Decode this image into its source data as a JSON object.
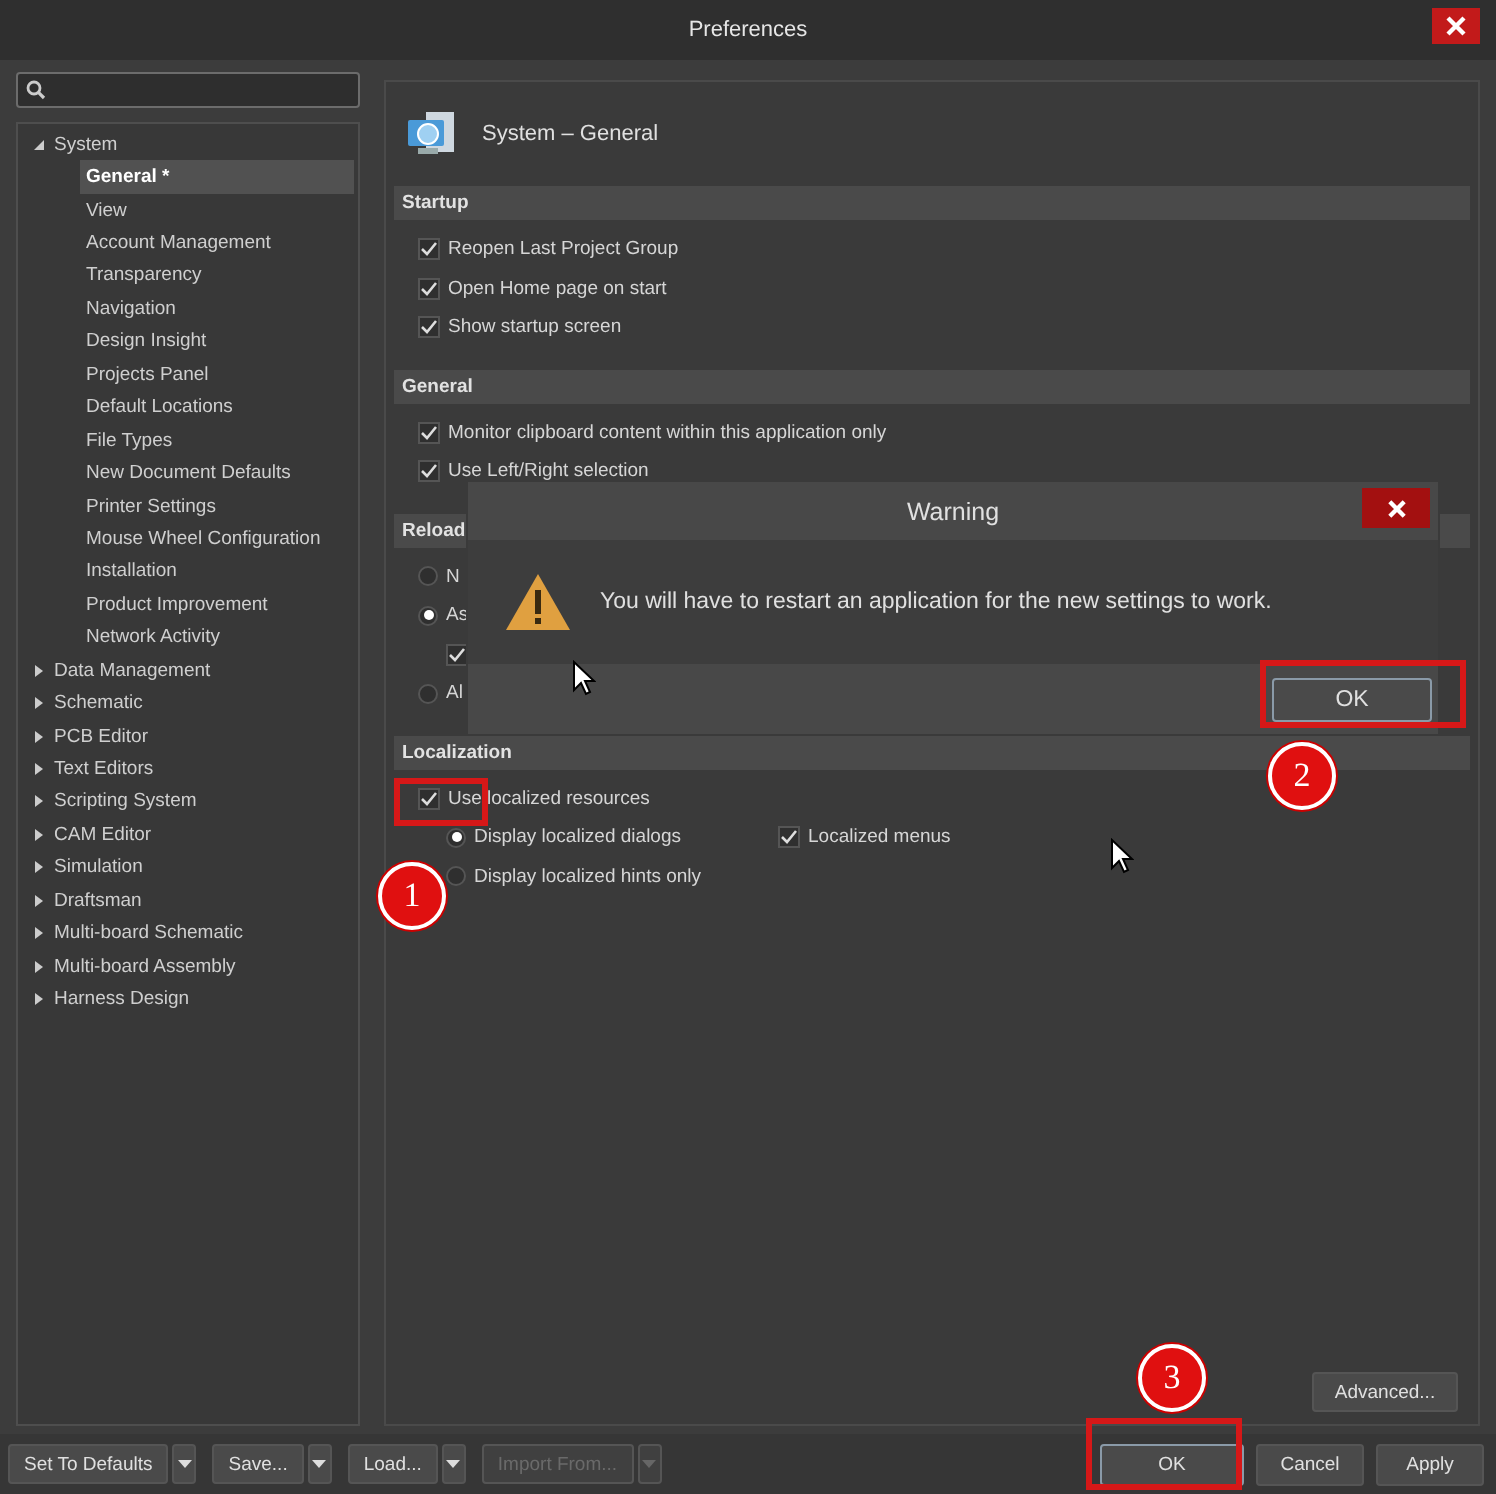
{
  "window": {
    "title": "Preferences"
  },
  "tree": [
    {
      "label": "System",
      "expanded": true,
      "selected": false,
      "children": [
        {
          "label": "General *",
          "selected": true
        },
        {
          "label": "View",
          "selected": false
        },
        {
          "label": "Account Management",
          "selected": false
        },
        {
          "label": "Transparency",
          "selected": false
        },
        {
          "label": "Navigation",
          "selected": false
        },
        {
          "label": "Design Insight",
          "selected": false
        },
        {
          "label": "Projects Panel",
          "selected": false
        },
        {
          "label": "Default Locations",
          "selected": false
        },
        {
          "label": "File Types",
          "selected": false
        },
        {
          "label": "New Document Defaults",
          "selected": false
        },
        {
          "label": "Printer Settings",
          "selected": false
        },
        {
          "label": "Mouse Wheel Configuration",
          "selected": false
        },
        {
          "label": "Installation",
          "selected": false
        },
        {
          "label": "Product Improvement",
          "selected": false
        },
        {
          "label": "Network Activity",
          "selected": false
        }
      ]
    },
    {
      "label": "Data Management",
      "expanded": false,
      "selected": false
    },
    {
      "label": "Schematic",
      "expanded": false,
      "selected": false
    },
    {
      "label": "PCB Editor",
      "expanded": false,
      "selected": false
    },
    {
      "label": "Text Editors",
      "expanded": false,
      "selected": false
    },
    {
      "label": "Scripting System",
      "expanded": false,
      "selected": false
    },
    {
      "label": "CAM Editor",
      "expanded": false,
      "selected": false
    },
    {
      "label": "Simulation",
      "expanded": false,
      "selected": false
    },
    {
      "label": "Draftsman",
      "expanded": false,
      "selected": false
    },
    {
      "label": "Multi-board Schematic",
      "expanded": false,
      "selected": false
    },
    {
      "label": "Multi-board Assembly",
      "expanded": false,
      "selected": false
    },
    {
      "label": "Harness Design",
      "expanded": false,
      "selected": false
    }
  ],
  "page": {
    "title": "System – General",
    "sections": [
      {
        "title": "Startup",
        "items": [
          {
            "kind": "checkbox",
            "label": "Reopen Last Project Group",
            "checked": true
          },
          {
            "kind": "checkbox",
            "label": "Open Home page on start",
            "checked": true
          },
          {
            "kind": "checkbox",
            "label": "Show startup screen",
            "checked": true
          }
        ]
      },
      {
        "title": "General",
        "items": [
          {
            "kind": "checkbox",
            "label": "Monitor clipboard content within this application only",
            "checked": true
          },
          {
            "kind": "checkbox",
            "label": "Use Left/Right selection",
            "checked": true
          }
        ]
      },
      {
        "title": "Reload",
        "items": [
          {
            "kind": "radio",
            "label": "N",
            "selected": false
          },
          {
            "kind": "radio",
            "label": "As",
            "selected": true,
            "children": [
              {
                "kind": "checkbox",
                "checked": true
              }
            ]
          },
          {
            "kind": "radio",
            "label": "Al",
            "selected": false
          }
        ]
      },
      {
        "title": "Localization",
        "items": [
          {
            "kind": "checkbox",
            "label": "Use localized resources",
            "checked": true,
            "children": [
              {
                "kind": "radio",
                "label": "Display localized dialogs",
                "selected": true,
                "beside": {
                  "kind": "checkbox",
                  "label": "Localized menus",
                  "checked": true
                }
              },
              {
                "kind": "radio",
                "label": "Display localized hints only",
                "selected": false
              }
            ]
          }
        ]
      }
    ]
  },
  "advanced_button": "Advanced...",
  "footer": {
    "left": [
      {
        "label": "Set To Defaults",
        "disabled": false
      },
      {
        "label": "Save...",
        "disabled": false
      },
      {
        "label": "Load...",
        "disabled": false
      },
      {
        "label": "Import From...",
        "disabled": true
      }
    ],
    "right": [
      {
        "label": "OK",
        "default": true
      },
      {
        "label": "Cancel",
        "default": false
      },
      {
        "label": "Apply",
        "default": false
      }
    ]
  },
  "warning": {
    "title": "Warning",
    "message": "You will have to restart an application for the new settings to work.",
    "button": "OK"
  },
  "annotations": [
    {
      "label": "1"
    },
    {
      "label": "2"
    },
    {
      "label": "3"
    }
  ]
}
